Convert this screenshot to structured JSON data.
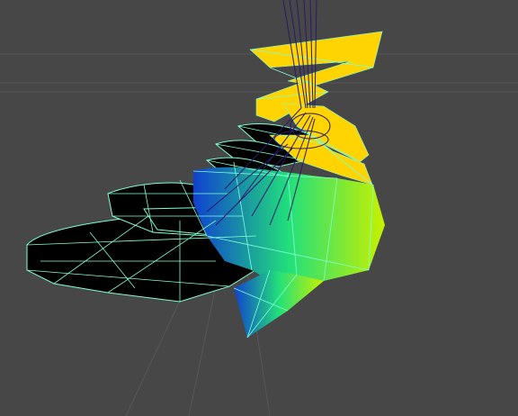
{
  "viewport": {
    "background": "#474747",
    "grid_color": "#575757",
    "axis_color": "#5e5e5e"
  },
  "mesh": {
    "wireframe_color": "#7fffd4",
    "dark_fill": "#000000",
    "gradient_colors": [
      "#ffd400",
      "#c8f000",
      "#6cf040",
      "#22e07a",
      "#0aa0d0",
      "#1040d0"
    ],
    "strings_color": "#2a1a6a"
  }
}
